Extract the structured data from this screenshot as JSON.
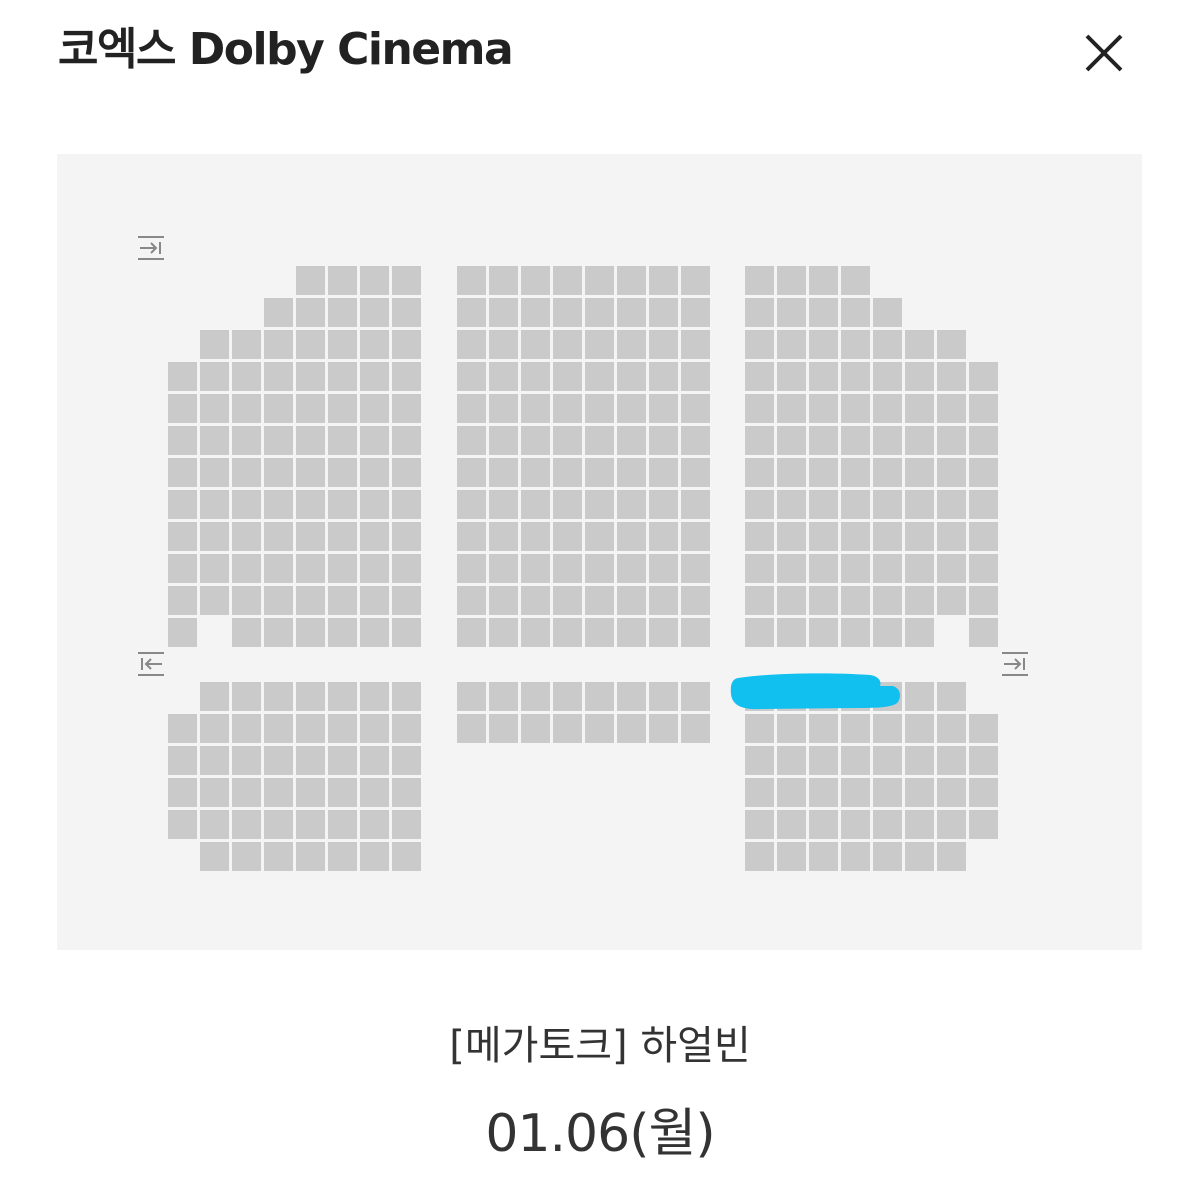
{
  "header": {
    "title": "코엑스 Dolby Cinema",
    "close_icon": "close-icon"
  },
  "seat_map": {
    "background_color": "#f4f4f4",
    "seat_color": "#cacaca",
    "highlight_color": "#12c0f0",
    "exit_icons": [
      "exit-right-arrow-icon",
      "exit-left-arrow-icon",
      "exit-right-arrow-icon"
    ]
  },
  "movie": {
    "title": "[메가토크] 하얼빈",
    "date": "01.06(월)"
  }
}
